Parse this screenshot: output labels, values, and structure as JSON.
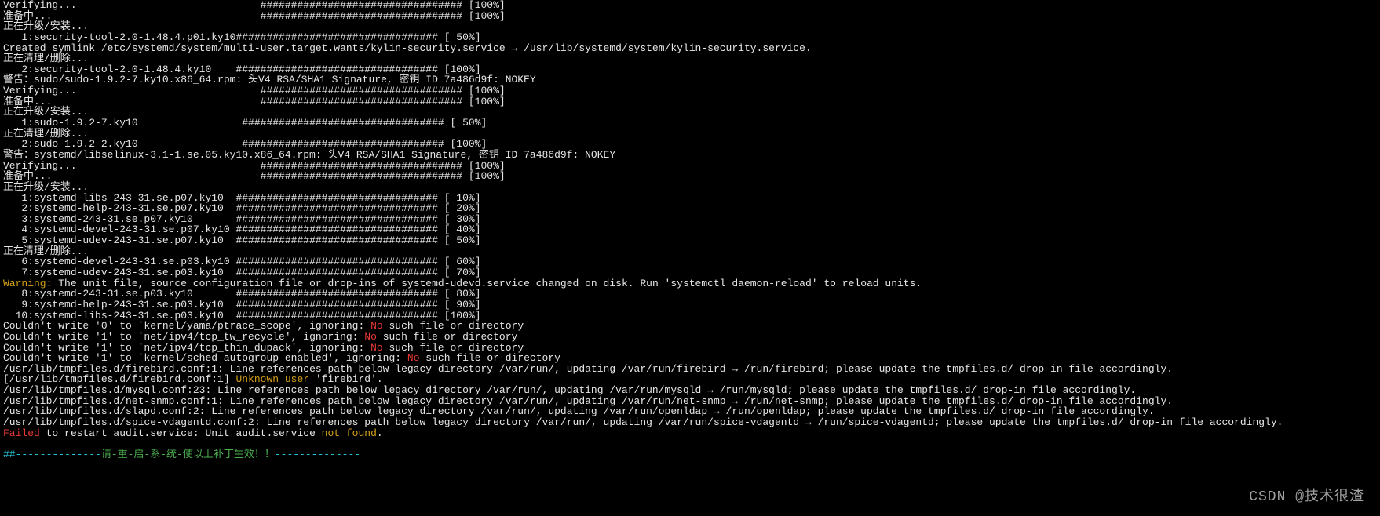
{
  "lines": [
    {
      "segs": [
        {
          "t": "Verifying...                              ################################# [100%]"
        }
      ]
    },
    {
      "segs": [
        {
          "t": "准备中...                                  ################################# [100%]"
        }
      ]
    },
    {
      "segs": [
        {
          "t": "正在升级/安装..."
        }
      ]
    },
    {
      "segs": [
        {
          "t": "   1:security-tool-2.0-1.48.4.p01.ky10################################# [ 50%]"
        }
      ]
    },
    {
      "segs": [
        {
          "t": "Created symlink /etc/systemd/system/multi-user.target.wants/kylin-security.service → /usr/lib/systemd/system/kylin-security.service."
        }
      ]
    },
    {
      "segs": [
        {
          "t": "正在清理/删除..."
        }
      ]
    },
    {
      "segs": [
        {
          "t": "   2:security-tool-2.0-1.48.4.ky10    ################################# [100%]"
        }
      ]
    },
    {
      "segs": [
        {
          "t": "警告：sudo/sudo-1.9.2-7.ky10.x86_64.rpm: 头V4 RSA/SHA1 Signature, 密钥 ID 7a486d9f: NOKEY"
        }
      ]
    },
    {
      "segs": [
        {
          "t": "Verifying...                              ################################# [100%]"
        }
      ]
    },
    {
      "segs": [
        {
          "t": "准备中...                                  ################################# [100%]"
        }
      ]
    },
    {
      "segs": [
        {
          "t": "正在升级/安装..."
        }
      ]
    },
    {
      "segs": [
        {
          "t": "   1:sudo-1.9.2-7.ky10                 ################################# [ 50%]"
        }
      ]
    },
    {
      "segs": [
        {
          "t": "正在清理/删除..."
        }
      ]
    },
    {
      "segs": [
        {
          "t": "   2:sudo-1.9.2-2.ky10                 ################################# [100%]"
        }
      ]
    },
    {
      "segs": [
        {
          "t": "警告：systemd/libselinux-3.1-1.se.05.ky10.x86_64.rpm: 头V4 RSA/SHA1 Signature, 密钥 ID 7a486d9f: NOKEY"
        }
      ]
    },
    {
      "segs": [
        {
          "t": "Verifying...                              ################################# [100%]"
        }
      ]
    },
    {
      "segs": [
        {
          "t": "准备中...                                  ################################# [100%]"
        }
      ]
    },
    {
      "segs": [
        {
          "t": "正在升级/安装..."
        }
      ]
    },
    {
      "segs": [
        {
          "t": "   1:systemd-libs-243-31.se.p07.ky10  ################################# [ 10%]"
        }
      ]
    },
    {
      "segs": [
        {
          "t": "   2:systemd-help-243-31.se.p07.ky10  ################################# [ 20%]"
        }
      ]
    },
    {
      "segs": [
        {
          "t": "   3:systemd-243-31.se.p07.ky10       ################################# [ 30%]"
        }
      ]
    },
    {
      "segs": [
        {
          "t": "   4:systemd-devel-243-31.se.p07.ky10 ################################# [ 40%]"
        }
      ]
    },
    {
      "segs": [
        {
          "t": "   5:systemd-udev-243-31.se.p07.ky10  ################################# [ 50%]"
        }
      ]
    },
    {
      "segs": [
        {
          "t": "正在清理/删除..."
        }
      ]
    },
    {
      "segs": [
        {
          "t": "   6:systemd-devel-243-31.se.p03.ky10 ################################# [ 60%]"
        }
      ]
    },
    {
      "segs": [
        {
          "t": "   7:systemd-udev-243-31.se.p03.ky10  ################################# [ 70%]"
        }
      ]
    },
    {
      "segs": [
        {
          "t": "Warning:",
          "c": "yellow"
        },
        {
          "t": " The unit file, source configuration file or drop-ins of systemd-udevd.service changed on disk. Run 'systemctl daemon-reload' to reload units."
        }
      ]
    },
    {
      "segs": [
        {
          "t": "   8:systemd-243-31.se.p03.ky10       ################################# [ 80%]"
        }
      ]
    },
    {
      "segs": [
        {
          "t": "   9:systemd-help-243-31.se.p03.ky10  ################################# [ 90%]"
        }
      ]
    },
    {
      "segs": [
        {
          "t": "  10:systemd-libs-243-31.se.p03.ky10  ################################# [100%]"
        }
      ]
    },
    {
      "segs": [
        {
          "t": "Couldn't write '0' to 'kernel/yama/ptrace_scope', ignoring: "
        },
        {
          "t": "No",
          "c": "red"
        },
        {
          "t": " such file or directory"
        }
      ]
    },
    {
      "segs": [
        {
          "t": "Couldn't write '1' to 'net/ipv4/tcp_tw_recycle', ignoring: "
        },
        {
          "t": "No",
          "c": "red"
        },
        {
          "t": " such file or directory"
        }
      ]
    },
    {
      "segs": [
        {
          "t": "Couldn't write '1' to 'net/ipv4/tcp_thin_dupack', ignoring: "
        },
        {
          "t": "No",
          "c": "red"
        },
        {
          "t": " such file or directory"
        }
      ]
    },
    {
      "segs": [
        {
          "t": "Couldn't write '1' to 'kernel/sched_autogroup_enabled', ignoring: "
        },
        {
          "t": "No",
          "c": "red"
        },
        {
          "t": " such file or directory"
        }
      ]
    },
    {
      "segs": [
        {
          "t": "/usr/lib/tmpfiles.d/firebird.conf:1: Line references path below legacy directory /var/run/, updating /var/run/firebird → /run/firebird; please update the tmpfiles.d/ drop-in file accordingly."
        }
      ]
    },
    {
      "segs": [
        {
          "t": "[/usr/lib/tmpfiles.d/firebird.conf:1] "
        },
        {
          "t": "Unknown user",
          "c": "yellow"
        },
        {
          "t": " 'firebird'."
        }
      ]
    },
    {
      "segs": [
        {
          "t": "/usr/lib/tmpfiles.d/mysql.conf:23: Line references path below legacy directory /var/run/, updating /var/run/mysqld → /run/mysqld; please update the tmpfiles.d/ drop-in file accordingly."
        }
      ]
    },
    {
      "segs": [
        {
          "t": "/usr/lib/tmpfiles.d/net-snmp.conf:1: Line references path below legacy directory /var/run/, updating /var/run/net-snmp → /run/net-snmp; please update the tmpfiles.d/ drop-in file accordingly."
        }
      ]
    },
    {
      "segs": [
        {
          "t": "/usr/lib/tmpfiles.d/slapd.conf:2: Line references path below legacy directory /var/run/, updating /var/run/openldap → /run/openldap; please update the tmpfiles.d/ drop-in file accordingly."
        }
      ]
    },
    {
      "segs": [
        {
          "t": "/usr/lib/tmpfiles.d/spice-vdagentd.conf:2: Line references path below legacy directory /var/run/, updating /var/run/spice-vdagentd → /run/spice-vdagentd; please update the tmpfiles.d/ drop-in file accordingly."
        }
      ]
    },
    {
      "segs": [
        {
          "t": "Failed",
          "c": "red"
        },
        {
          "t": " to restart audit.service: Unit audit.service "
        },
        {
          "t": "not found",
          "c": "yellow"
        },
        {
          "t": "."
        }
      ]
    },
    {
      "segs": [
        {
          "t": " "
        }
      ]
    },
    {
      "segs": [
        {
          "t": "##--------------",
          "c": "cyan"
        },
        {
          "t": "请-重-启-系-统-使以上补丁生效！！",
          "c": "green"
        },
        {
          "t": "--------------",
          "c": "cyan"
        }
      ]
    }
  ],
  "watermark": "CSDN @技术很渣"
}
